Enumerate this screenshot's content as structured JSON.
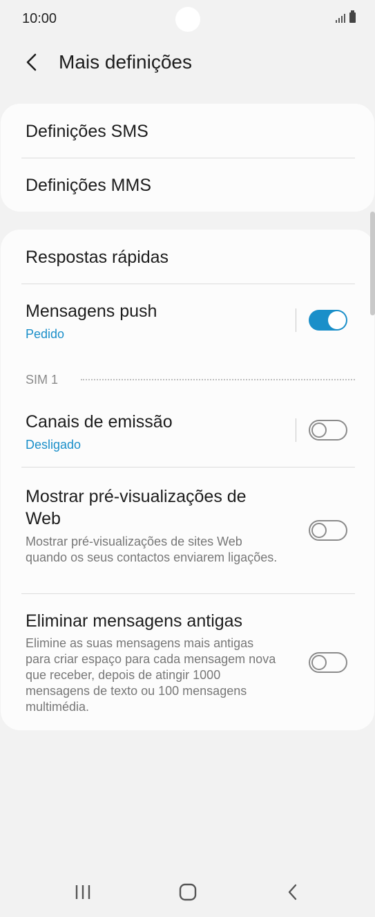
{
  "status_bar": {
    "time": "10:00"
  },
  "header": {
    "title": "Mais definições"
  },
  "group1": {
    "items": [
      {
        "label": "Definições SMS"
      },
      {
        "label": "Definições MMS"
      }
    ]
  },
  "group2": {
    "quick_replies": {
      "label": "Respostas rápidas"
    },
    "push": {
      "label": "Mensagens push",
      "sub": "Pedido",
      "enabled": true
    },
    "section_label": "SIM 1",
    "broadcast": {
      "label": "Canais de emissão",
      "sub": "Desligado",
      "enabled": false
    },
    "web_preview": {
      "label": "Mostrar pré-visualizações de Web",
      "desc": "Mostrar pré-visualizações de sites Web quando os seus contactos enviarem ligações.",
      "enabled": false
    },
    "delete_old": {
      "label": "Eliminar mensagens antigas",
      "desc": "Elimine as suas mensagens mais antigas para criar espaço para cada mensagem nova que receber, depois de atingir 1000 mensagens de texto ou 100 mensagens multimédia.",
      "enabled": false
    }
  },
  "colors": {
    "accent": "#1a8fc9",
    "background": "#f2f2f2",
    "card": "#fcfcfc"
  },
  "nav": {
    "icons": [
      "recent-apps-icon",
      "home-icon",
      "back-icon"
    ]
  }
}
